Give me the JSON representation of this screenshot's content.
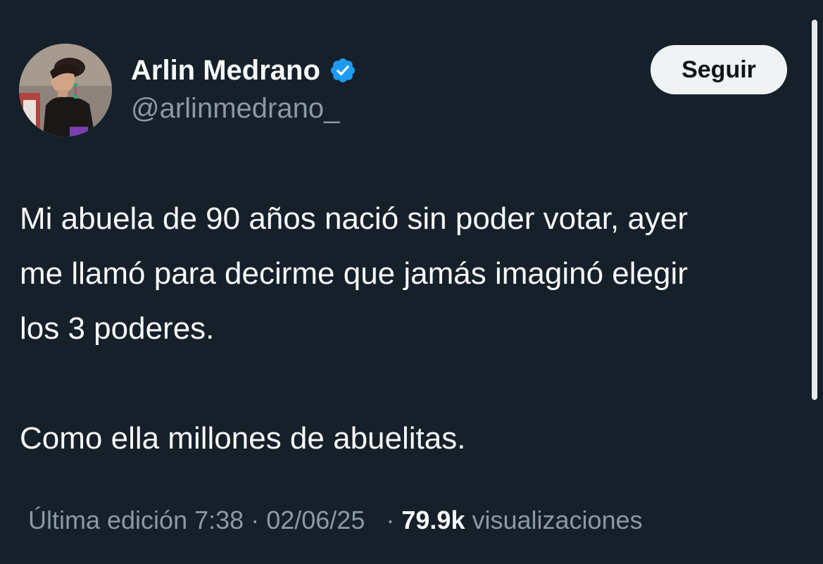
{
  "author": {
    "name": "Arlin Medrano",
    "handle": "@arlinmedrano_",
    "verified_icon": "verified-badge-icon",
    "verified_color": "#1d9bf0"
  },
  "follow_button": {
    "label": "Seguir"
  },
  "tweet": {
    "paragraph_1_line_1": "Mi abuela de 90 años nació sin poder votar, ayer",
    "paragraph_1_line_2": "me llamó para decirme que jamás imaginó elegir",
    "paragraph_1_line_3": "los 3 poderes.",
    "paragraph_2": "Como ella millones de abuelitas."
  },
  "meta": {
    "edited_label": "Última edición",
    "time": "7:38",
    "separator": "·",
    "date": "02/06/25",
    "views_count": "79.9k",
    "views_label": "visualizaciones"
  },
  "colors": {
    "background": "#15202b",
    "text_primary": "#f7f9f9",
    "text_secondary": "#8b98a5",
    "button_bg": "#eff3f4"
  }
}
